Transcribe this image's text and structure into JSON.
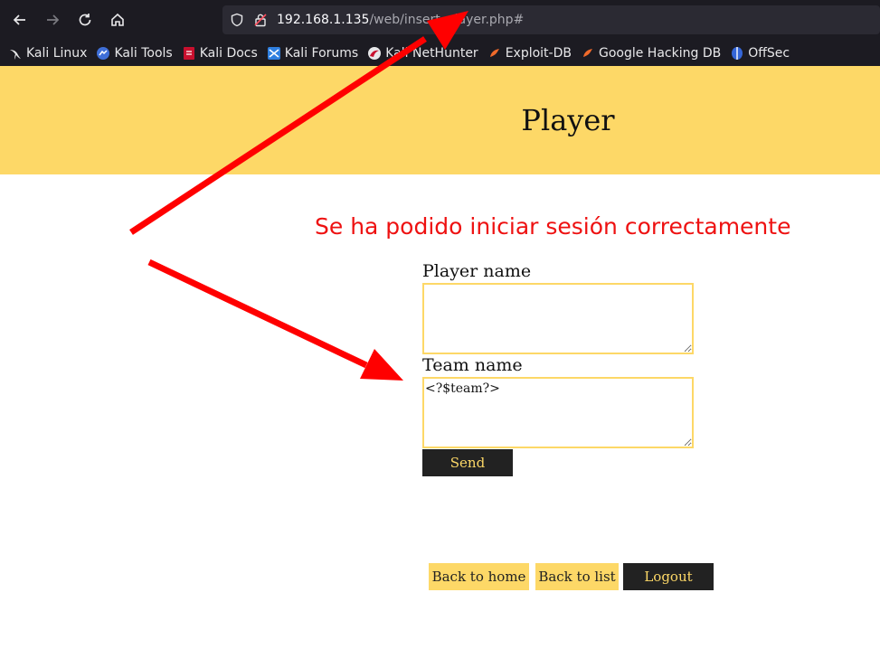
{
  "browser": {
    "url_host": "192.168.1.135",
    "url_path": "/web/insert_player.php#",
    "bookmarks": [
      {
        "label": "Kali Linux",
        "icon": "kali-dragon-icon"
      },
      {
        "label": "Kali Tools",
        "icon": "kali-tools-icon"
      },
      {
        "label": "Kali Docs",
        "icon": "kali-docs-icon"
      },
      {
        "label": "Kali Forums",
        "icon": "kali-forums-icon"
      },
      {
        "label": "Kali NetHunter",
        "icon": "kali-nethunter-icon"
      },
      {
        "label": "Exploit-DB",
        "icon": "exploit-db-icon"
      },
      {
        "label": "Google Hacking DB",
        "icon": "google-hacking-db-icon"
      },
      {
        "label": "OffSec",
        "icon": "offsec-icon"
      }
    ]
  },
  "page": {
    "title": "Player",
    "message": "Se ha podido iniciar sesión correctamente",
    "form": {
      "player_label": "Player name",
      "player_value": "",
      "team_label": "Team name",
      "team_value": "<?$team?>",
      "send_label": "Send"
    },
    "links": {
      "home": "Back to home",
      "list": "Back to list",
      "logout": "Logout"
    }
  },
  "colors": {
    "accent": "#fdd867",
    "dark": "#222222",
    "message": "#ee1111",
    "annotation_arrow": "#ff0000"
  }
}
